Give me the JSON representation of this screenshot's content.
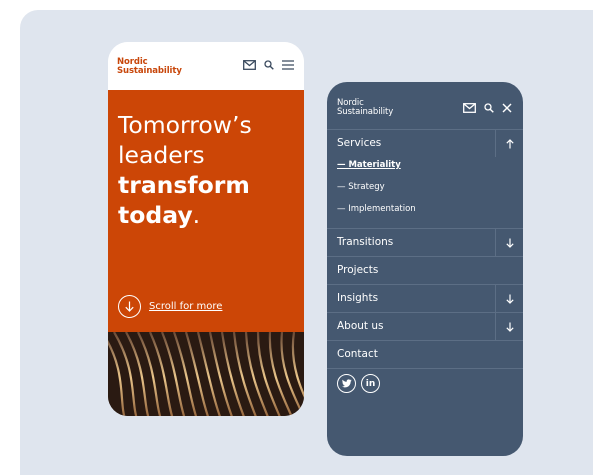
{
  "brand": {
    "line1": "Nordic",
    "line2": "Sustainability",
    "accent": "#cc4606",
    "navy": "#455870"
  },
  "hero": {
    "line1": "Tomorrow’s",
    "line2": "leaders",
    "line3": "transform",
    "line4": "today",
    "period": ".",
    "scroll_label": "Scroll for more"
  },
  "icons": {
    "mail": "mail-icon",
    "search": "search-icon",
    "menu": "hamburger-icon",
    "close": "close-icon"
  },
  "menu": {
    "services": "Services",
    "sub1": "— Materiality",
    "sub2": "— Strategy",
    "sub3": "— Implementation",
    "transitions": "Transitions",
    "projects": "Projects",
    "insights": "Insights",
    "about": "About us",
    "contact": "Contact"
  },
  "social": {
    "twitter": "twitter-icon",
    "linkedin": "in"
  }
}
